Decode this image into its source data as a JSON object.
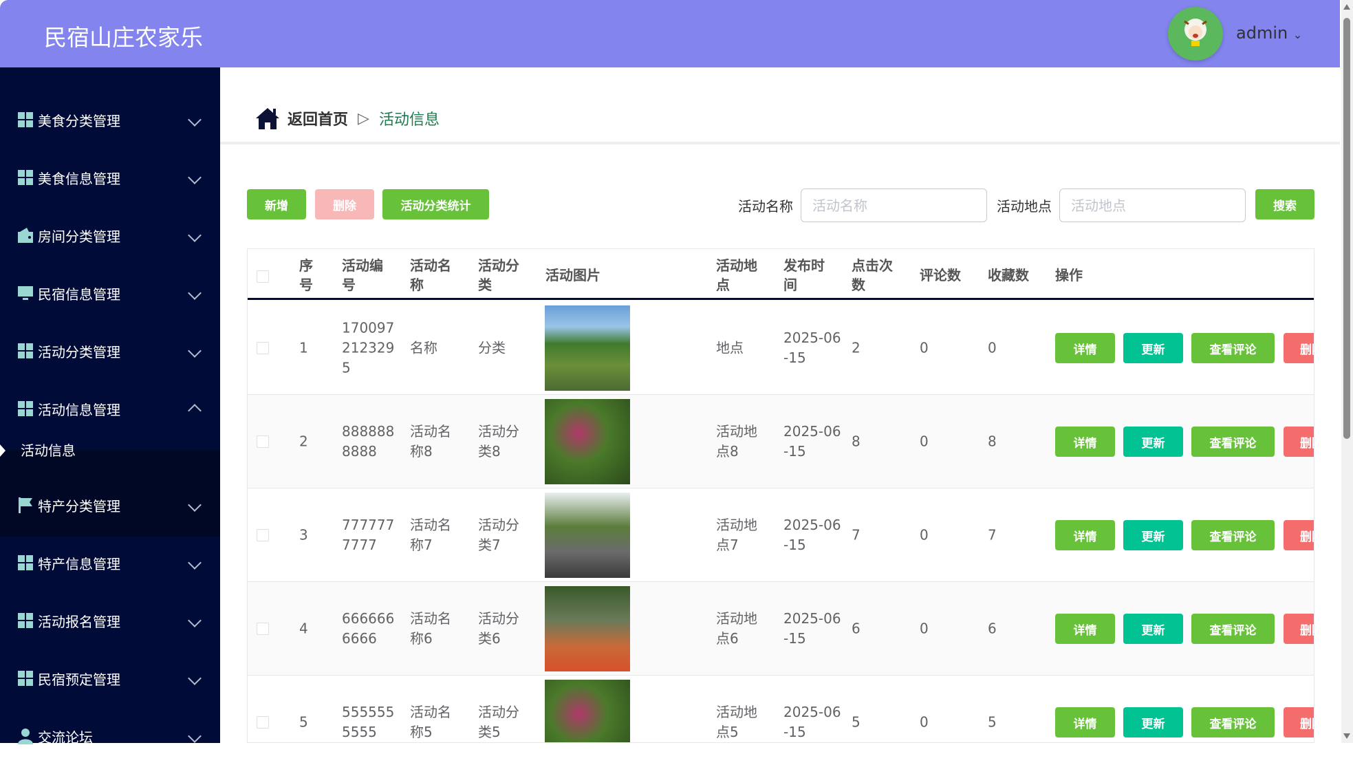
{
  "header": {
    "title": "民宿山庄农家乐",
    "user": "admin"
  },
  "sidebar": {
    "items": [
      {
        "label": "美食分类管理",
        "icon": "grid-icon"
      },
      {
        "label": "美食信息管理",
        "icon": "grid-icon"
      },
      {
        "label": "房间分类管理",
        "icon": "wallet-icon"
      },
      {
        "label": "民宿信息管理",
        "icon": "monitor-icon"
      },
      {
        "label": "活动分类管理",
        "icon": "grid-icon"
      },
      {
        "label": "活动信息管理",
        "icon": "grid-icon",
        "expanded": true
      },
      {
        "label": "特产分类管理",
        "icon": "flag-icon"
      },
      {
        "label": "特产信息管理",
        "icon": "grid-icon"
      },
      {
        "label": "活动报名管理",
        "icon": "grid-icon"
      },
      {
        "label": "民宿预定管理",
        "icon": "grid-icon"
      },
      {
        "label": "交流论坛",
        "icon": "user-icon"
      }
    ],
    "sub_item": "活动信息"
  },
  "breadcrumb": {
    "home": "返回首页",
    "current": "活动信息"
  },
  "toolbar": {
    "add": "新增",
    "delete": "删除",
    "stats": "活动分类统计",
    "name_label": "活动名称",
    "name_placeholder": "活动名称",
    "place_label": "活动地点",
    "place_placeholder": "活动地点",
    "search": "搜索"
  },
  "table": {
    "headers": [
      "序\n号",
      "活动编\n号",
      "活动名\n称",
      "活动分\n类",
      "活动图片",
      "活动地\n点",
      "发布时\n间",
      "点击次\n数",
      "评论数",
      "收藏数",
      "操作"
    ],
    "actions": {
      "detail": "详情",
      "update": "更新",
      "comments": "查看评论",
      "delete": "删除"
    },
    "rows": [
      {
        "idx": "1",
        "code": "170097\n212329\n5",
        "name": "名称",
        "cat": "分类",
        "place": "地点",
        "time": "2025-06\n-15",
        "clicks": "2",
        "comments": "0",
        "favs": "0"
      },
      {
        "idx": "2",
        "code": "888888\n8888",
        "name": "活动名\n称8",
        "cat": "活动分\n类8",
        "place": "活动地\n点8",
        "time": "2025-06\n-15",
        "clicks": "8",
        "comments": "0",
        "favs": "8"
      },
      {
        "idx": "3",
        "code": "777777\n7777",
        "name": "活动名\n称7",
        "cat": "活动分\n类7",
        "place": "活动地\n点7",
        "time": "2025-06\n-15",
        "clicks": "7",
        "comments": "0",
        "favs": "7"
      },
      {
        "idx": "4",
        "code": "666666\n6666",
        "name": "活动名\n称6",
        "cat": "活动分\n类6",
        "place": "活动地\n点6",
        "time": "2025-06\n-15",
        "clicks": "6",
        "comments": "0",
        "favs": "6"
      },
      {
        "idx": "5",
        "code": "555555\n5555",
        "name": "活动名\n称5",
        "cat": "活动分\n类5",
        "place": "活动地\n点5",
        "time": "2025-06\n-15",
        "clicks": "5",
        "comments": "0",
        "favs": "5"
      }
    ]
  },
  "colors": {
    "header": "#8384ee",
    "sidebar": "#000b38",
    "green": "#67c23a",
    "teal": "#00c292",
    "red": "#f56c6c"
  }
}
